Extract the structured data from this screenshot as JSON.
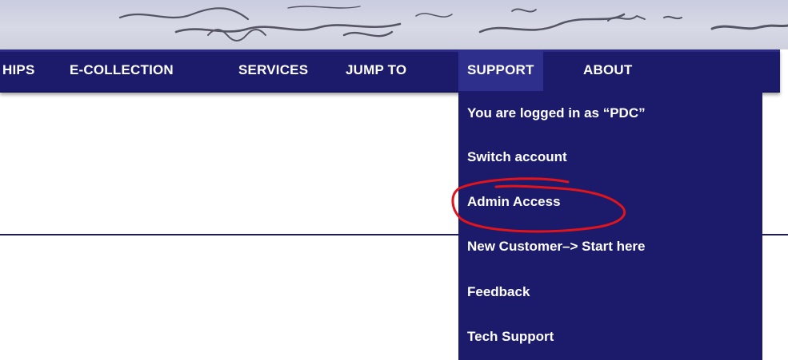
{
  "nav": {
    "items": [
      {
        "label": "HIPS"
      },
      {
        "label": "E-COLLECTION"
      },
      {
        "label": "SERVICES"
      },
      {
        "label": "JUMP TO"
      },
      {
        "label": "SUPPORT"
      },
      {
        "label": "ABOUT"
      }
    ],
    "active": "SUPPORT"
  },
  "support_menu": {
    "items": [
      {
        "label": "You are logged in as “PDC”"
      },
      {
        "label": "Switch account"
      },
      {
        "label": "Admin Access"
      },
      {
        "label": "New Customer–> Start here"
      },
      {
        "label": "Feedback"
      },
      {
        "label": "Tech Support"
      }
    ],
    "highlighted": "Admin Access"
  },
  "colors": {
    "nav_background": "#1b1a6b",
    "nav_active": "#2e2f8d",
    "annotation_circle": "#e0141b",
    "banner": "#d0d2e2"
  },
  "icons": {
    "annotation": "hand-drawn-circle"
  }
}
